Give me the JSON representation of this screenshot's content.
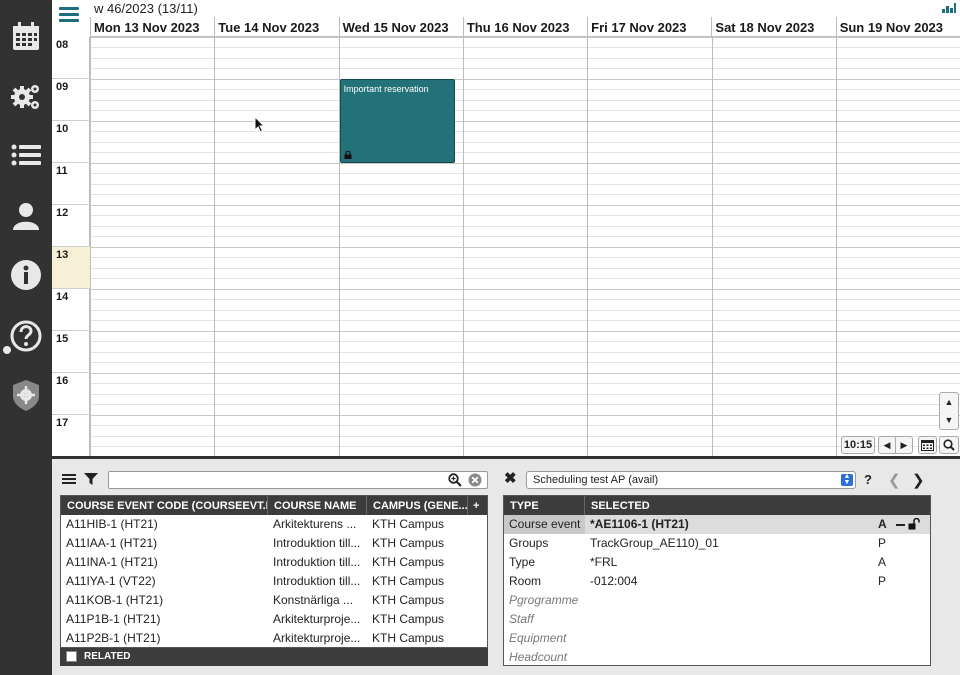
{
  "topbar": {
    "week_label": "w 46/2023 (13/11)"
  },
  "sidebar": {
    "items": [
      {
        "name": "calendar-icon"
      },
      {
        "name": "gears-icon"
      },
      {
        "name": "list-icon"
      },
      {
        "name": "user-icon"
      },
      {
        "name": "info-icon"
      },
      {
        "name": "help-icon"
      },
      {
        "name": "admin-shield-icon"
      }
    ]
  },
  "calendar": {
    "days": [
      "Mon 13 Nov 2023",
      "Tue 14 Nov 2023",
      "Wed 15 Nov 2023",
      "Thu 16 Nov 2023",
      "Fri 17 Nov 2023",
      "Sat 18 Nov 2023",
      "Sun 19 Nov 2023"
    ],
    "hours": [
      "08",
      "09",
      "10",
      "11",
      "12",
      "13",
      "14",
      "15",
      "16",
      "17"
    ],
    "highlighted_hour": "13",
    "reservation": {
      "title": "Important reservation",
      "day": "Wed 15 Nov 2023",
      "start": "09:00",
      "end": "11:00",
      "color": "#237279",
      "locked": true
    },
    "current_time": "10:15"
  },
  "left_panel": {
    "search_value": "",
    "columns": [
      "COURSE EVENT CODE (COURSEEVT.E...",
      "COURSE NAME",
      "CAMPUS (GENE...",
      "+"
    ],
    "rows": [
      [
        "A11HIB-1 (HT21)",
        "Arkitekturens ...",
        "KTH Campus"
      ],
      [
        "A11IAA-1 (HT21)",
        "Introduktion till...",
        "KTH Campus"
      ],
      [
        "A11INA-1 (HT21)",
        "Introduktion till...",
        "KTH Campus"
      ],
      [
        "A11IYA-1 (VT22)",
        "Introduktion till...",
        "KTH Campus"
      ],
      [
        "A11KOB-1 (HT21)",
        "Konstnärliga ...",
        "KTH Campus"
      ],
      [
        "A11P1B-1 (HT21)",
        "Arkitekturproje...",
        "KTH Campus"
      ],
      [
        "A11P2B-1 (HT21)",
        "Arkitekturproje...",
        "KTH Campus"
      ]
    ],
    "related_label": "RELATED"
  },
  "right_panel": {
    "select_value": "Scheduling test AP (avail)",
    "help_label": "?",
    "columns": [
      "TYPE",
      "SELECTED"
    ],
    "rows": [
      {
        "type": "Course event",
        "value": "*AE1106-1 (HT21)",
        "flag": "A"
      },
      {
        "type": "Groups",
        "value": "TrackGroup_AE110)_01",
        "flag": "P"
      },
      {
        "type": "Type",
        "value": "*FRL",
        "flag": "A"
      },
      {
        "type": "Room",
        "value": "-012:004",
        "flag": "P"
      },
      {
        "type": "Pgrogramme",
        "value": "",
        "flag": ""
      },
      {
        "type": "Staff",
        "value": "",
        "flag": ""
      },
      {
        "type": "Equipment",
        "value": "",
        "flag": ""
      },
      {
        "type": "Headcount",
        "value": "",
        "flag": ""
      }
    ]
  },
  "colors": {
    "sidebar_bg": "#323232",
    "accent": "#1d6f7e",
    "reservation": "#237279",
    "highlight_hour": "#f8f0d6"
  }
}
